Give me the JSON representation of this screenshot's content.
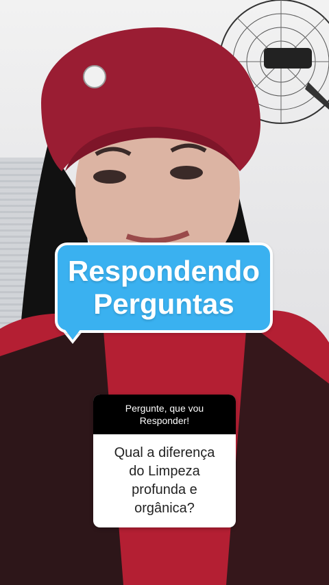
{
  "bubble": {
    "line1": "Respondendo",
    "line2": "Perguntas"
  },
  "question_box": {
    "header_line1": "Pergunte, que vou",
    "header_line2": "Responder!",
    "question_line1": "Qual a diferença",
    "question_line2": "do Limpeza",
    "question_line3": "profunda e",
    "question_line4": "orgânica?"
  },
  "colors": {
    "bubble": "#3ab1f0",
    "hat": "#9a1d33",
    "shirt": "#b41f33",
    "hair": "#111111"
  }
}
